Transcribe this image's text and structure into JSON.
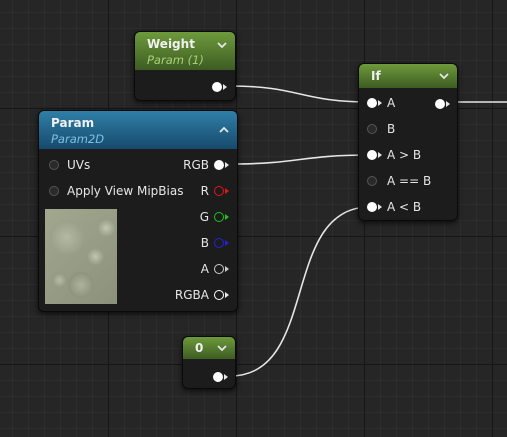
{
  "nodes": {
    "weight": {
      "title": "Weight",
      "subtitle": "Param (1)"
    },
    "param": {
      "title": "Param",
      "subtitle": "Param2D",
      "inputs": [
        "UVs",
        "Apply View MipBias"
      ],
      "outputs": [
        "RGB",
        "R",
        "G",
        "B",
        "A",
        "RGBA"
      ]
    },
    "if": {
      "title": "If",
      "inputs": [
        "A",
        "B",
        "A > B",
        "A == B",
        "A < B"
      ]
    },
    "constant": {
      "title": "0"
    }
  },
  "colors": {
    "pin_r": "#e01818",
    "pin_g": "#1ec21e",
    "pin_b": "#2323d8",
    "pin_white": "#ffffff",
    "green_header": "#5a8a30",
    "blue_header": "#1e5a82"
  },
  "icons": {
    "collapse": "chevron-down-icon",
    "expand": "chevron-up-icon"
  }
}
